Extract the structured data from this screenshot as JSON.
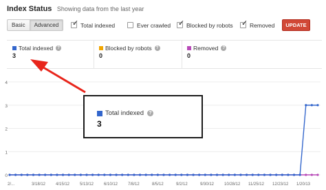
{
  "header": {
    "title": "Index Status",
    "subtitle": "Showing data from the last year"
  },
  "view_toggle": {
    "basic_label": "Basic",
    "advanced_label": "Advanced",
    "selected": "Advanced"
  },
  "filters": [
    {
      "label": "Total indexed",
      "checked": true
    },
    {
      "label": "Ever crawled",
      "checked": false
    },
    {
      "label": "Blocked by robots",
      "checked": true
    },
    {
      "label": "Removed",
      "checked": true
    }
  ],
  "update_label": "UPDATE",
  "metrics": [
    {
      "label": "Total indexed",
      "value": "3",
      "color": "#3366cc",
      "help_icon": "help-icon"
    },
    {
      "label": "Blocked by robots",
      "value": "0",
      "color": "#f2a600",
      "help_icon": "help-icon"
    },
    {
      "label": "Removed",
      "value": "0",
      "color": "#b84ab8",
      "help_icon": "help-icon"
    }
  ],
  "callout": {
    "label": "Total indexed",
    "value": "3",
    "color": "#3366cc"
  },
  "colors": {
    "accent_red": "#d14836",
    "arrow": "#e8251b",
    "total_indexed": "#3366cc",
    "removed": "#b84ab8"
  },
  "chart_data": {
    "type": "line",
    "y_ticks": [
      "4",
      "3",
      "2",
      "1",
      "0"
    ],
    "ylim": [
      0,
      4
    ],
    "x_tick_labels": [
      "2/...",
      "3/18/12",
      "4/15/12",
      "5/13/12",
      "6/10/12",
      "7/8/12",
      "8/5/12",
      "9/2/12",
      "9/30/12",
      "10/28/12",
      "11/25/12",
      "12/23/12",
      "1/20/13"
    ],
    "series": [
      {
        "name": "Total indexed",
        "color": "#3366cc",
        "values": [
          0,
          0,
          0,
          0,
          0,
          0,
          0,
          0,
          0,
          0,
          0,
          0,
          0,
          0,
          0,
          0,
          0,
          0,
          0,
          0,
          0,
          0,
          0,
          0,
          0,
          0,
          0,
          0,
          0,
          0,
          0,
          0,
          0,
          0,
          0,
          0,
          0,
          0,
          0,
          0,
          0,
          0,
          0,
          0,
          0,
          0,
          0,
          0,
          0,
          0,
          3,
          3,
          3
        ]
      },
      {
        "name": "Removed",
        "color": "#b84ab8",
        "values": [
          0,
          0,
          0,
          0,
          0,
          0,
          0,
          0,
          0,
          0,
          0,
          0,
          0,
          0,
          0,
          0,
          0,
          0,
          0,
          0,
          0,
          0,
          0,
          0,
          0,
          0,
          0,
          0,
          0,
          0,
          0,
          0,
          0,
          0,
          0,
          0,
          0,
          0,
          0,
          0,
          0,
          0,
          0,
          0,
          0,
          0,
          0,
          0,
          0,
          0,
          0,
          0,
          0
        ]
      }
    ]
  }
}
